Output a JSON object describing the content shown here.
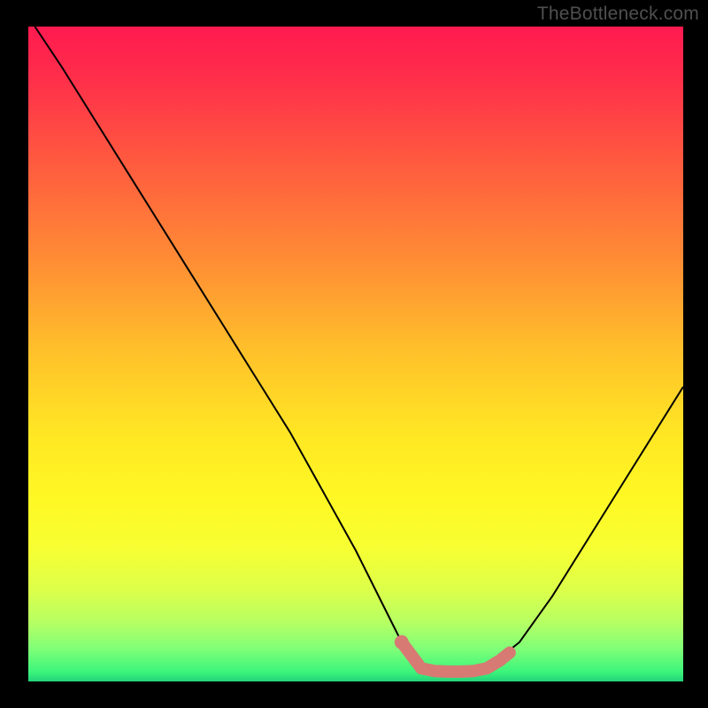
{
  "watermark": "TheBottleneck.com",
  "chart_data": {
    "type": "line",
    "title": "",
    "xlabel": "",
    "ylabel": "",
    "xlim": [
      0,
      100
    ],
    "ylim": [
      0,
      100
    ],
    "grid": false,
    "series": [
      {
        "name": "curve",
        "color": "#000000",
        "x": [
          1,
          5,
          10,
          15,
          20,
          25,
          30,
          35,
          40,
          45,
          50,
          55,
          57,
          60,
          62,
          65,
          68,
          70,
          75,
          80,
          85,
          90,
          95,
          100
        ],
        "values": [
          100,
          94,
          86,
          78,
          70,
          62,
          54,
          46,
          38,
          29,
          20,
          10,
          6,
          2,
          1.6,
          1.5,
          1.6,
          2,
          6,
          13,
          21,
          29,
          37,
          45
        ]
      }
    ],
    "highlight": {
      "name": "flat-zone",
      "color": "#d77a74",
      "points": [
        {
          "x": 57,
          "y": 6
        },
        {
          "x": 60,
          "y": 2
        },
        {
          "x": 62,
          "y": 1.6
        },
        {
          "x": 64,
          "y": 1.5
        },
        {
          "x": 66,
          "y": 1.5
        },
        {
          "x": 68,
          "y": 1.6
        },
        {
          "x": 70,
          "y": 2
        },
        {
          "x": 72,
          "y": 3.2
        },
        {
          "x": 73.5,
          "y": 4.4
        }
      ]
    },
    "background_gradient": {
      "stops": [
        {
          "pos": 0.0,
          "color": "#ff1a50"
        },
        {
          "pos": 0.08,
          "color": "#ff2f4a"
        },
        {
          "pos": 0.2,
          "color": "#ff5840"
        },
        {
          "pos": 0.35,
          "color": "#ff8a35"
        },
        {
          "pos": 0.5,
          "color": "#ffc22a"
        },
        {
          "pos": 0.62,
          "color": "#ffe624"
        },
        {
          "pos": 0.72,
          "color": "#fff824"
        },
        {
          "pos": 0.8,
          "color": "#f6ff33"
        },
        {
          "pos": 0.86,
          "color": "#dcff4a"
        },
        {
          "pos": 0.91,
          "color": "#b6ff63"
        },
        {
          "pos": 0.95,
          "color": "#80ff78"
        },
        {
          "pos": 0.985,
          "color": "#3cf57a"
        },
        {
          "pos": 1.0,
          "color": "#22d27a"
        }
      ]
    }
  }
}
